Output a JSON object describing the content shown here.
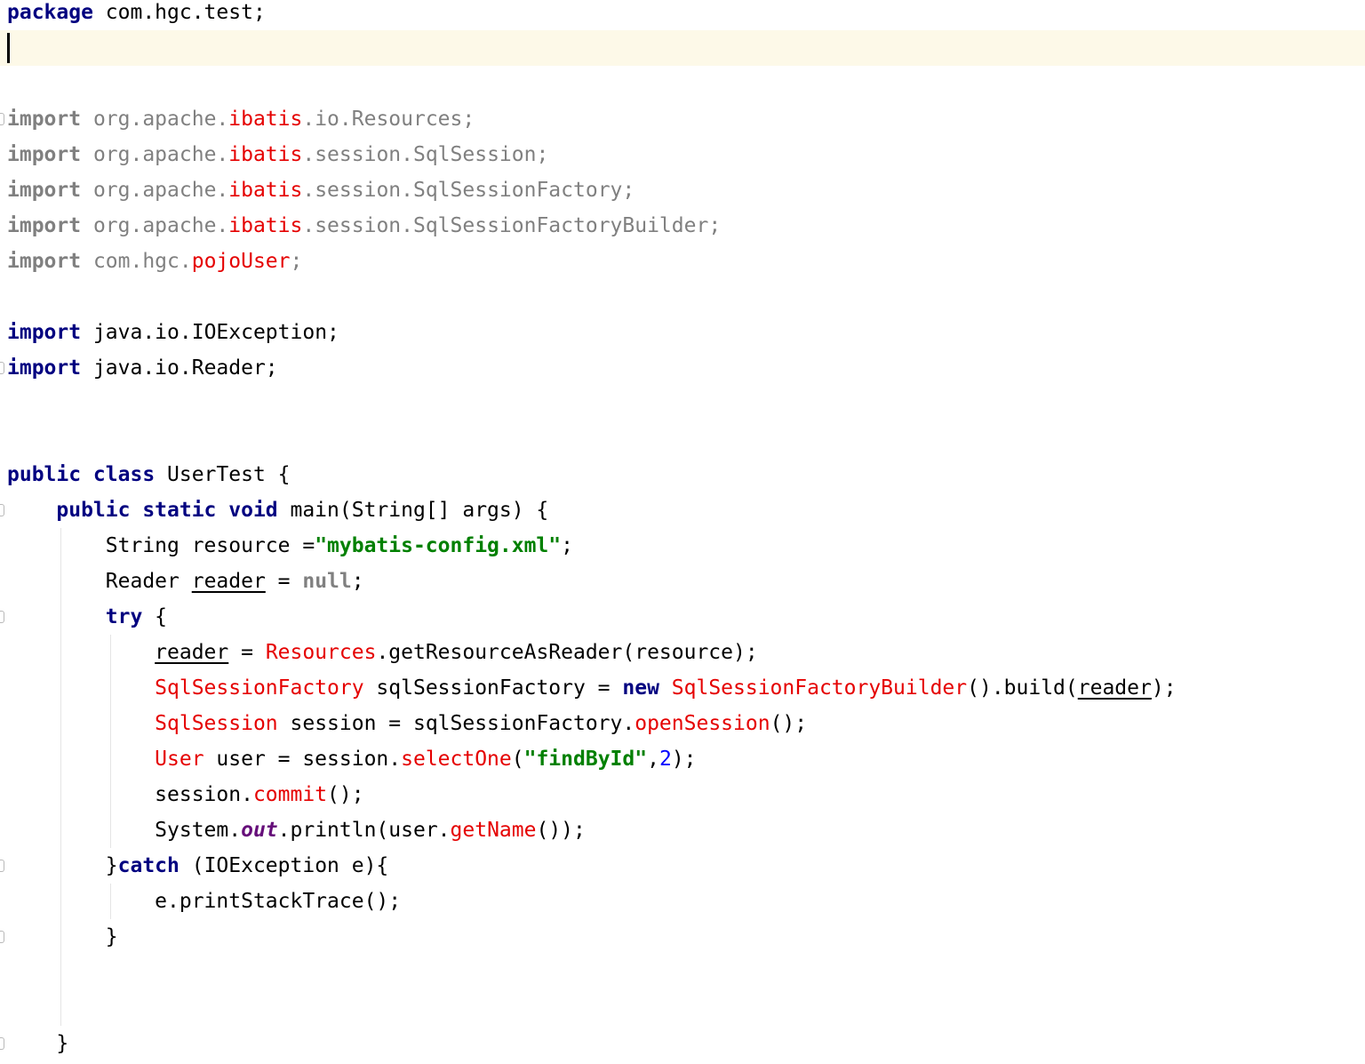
{
  "editor": {
    "lines": [
      {
        "tokens": [
          {
            "t": "package",
            "c": "kw"
          },
          {
            "t": " com.hgc.test;"
          }
        ]
      },
      {
        "tokens": []
      },
      {
        "tokens": []
      },
      {
        "tokens": [
          {
            "t": "import",
            "c": "kwg"
          },
          {
            "t": " org.apache.",
            "c": "gray"
          },
          {
            "t": "ibatis",
            "c": "err"
          },
          {
            "t": ".io.Resources;",
            "c": "gray"
          }
        ]
      },
      {
        "tokens": [
          {
            "t": "import",
            "c": "kwg"
          },
          {
            "t": " org.apache.",
            "c": "gray"
          },
          {
            "t": "ibatis",
            "c": "err"
          },
          {
            "t": ".session.SqlSession;",
            "c": "gray"
          }
        ]
      },
      {
        "tokens": [
          {
            "t": "import",
            "c": "kwg"
          },
          {
            "t": " org.apache.",
            "c": "gray"
          },
          {
            "t": "ibatis",
            "c": "err"
          },
          {
            "t": ".session.SqlSessionFactory;",
            "c": "gray"
          }
        ]
      },
      {
        "tokens": [
          {
            "t": "import",
            "c": "kwg"
          },
          {
            "t": " org.apache.",
            "c": "gray"
          },
          {
            "t": "ibatis",
            "c": "err"
          },
          {
            "t": ".session.SqlSessionFactoryBuilder;",
            "c": "gray"
          }
        ]
      },
      {
        "tokens": [
          {
            "t": "import",
            "c": "kwg"
          },
          {
            "t": " com.hgc.",
            "c": "gray"
          },
          {
            "t": "pojoUser",
            "c": "err"
          },
          {
            "t": ";",
            "c": "gray"
          }
        ]
      },
      {
        "tokens": []
      },
      {
        "tokens": [
          {
            "t": "import",
            "c": "kw"
          },
          {
            "t": " java.io.IOException;"
          }
        ]
      },
      {
        "tokens": [
          {
            "t": "import",
            "c": "kw"
          },
          {
            "t": " java.io.Reader;"
          }
        ]
      },
      {
        "tokens": []
      },
      {
        "tokens": []
      },
      {
        "tokens": [
          {
            "t": "public class",
            "c": "kw"
          },
          {
            "t": " UserTest {"
          }
        ]
      },
      {
        "tokens": [
          {
            "t": "    "
          },
          {
            "t": "public static void",
            "c": "kw"
          },
          {
            "t": " main(String[] args) {"
          }
        ]
      },
      {
        "tokens": [
          {
            "t": "        String resource ="
          },
          {
            "t": "\"mybatis-config.xml\"",
            "c": "str"
          },
          {
            "t": ";"
          }
        ]
      },
      {
        "tokens": [
          {
            "t": "        Reader "
          },
          {
            "t": "reader",
            "c": "ul"
          },
          {
            "t": " = "
          },
          {
            "t": "null",
            "c": "kwg"
          },
          {
            "t": ";"
          }
        ]
      },
      {
        "tokens": [
          {
            "t": "        "
          },
          {
            "t": "try",
            "c": "kw"
          },
          {
            "t": " {"
          }
        ]
      },
      {
        "tokens": [
          {
            "t": "            "
          },
          {
            "t": "reader",
            "c": "ul"
          },
          {
            "t": " = "
          },
          {
            "t": "Resources",
            "c": "err"
          },
          {
            "t": ".getResourceAsReader(resource);"
          }
        ]
      },
      {
        "tokens": [
          {
            "t": "            "
          },
          {
            "t": "SqlSessionFactory",
            "c": "err"
          },
          {
            "t": " sqlSessionFactory = "
          },
          {
            "t": "new",
            "c": "kw"
          },
          {
            "t": " "
          },
          {
            "t": "SqlSessionFactoryBuilder",
            "c": "err"
          },
          {
            "t": "().build("
          },
          {
            "t": "reader",
            "c": "ul"
          },
          {
            "t": ");"
          }
        ]
      },
      {
        "tokens": [
          {
            "t": "            "
          },
          {
            "t": "SqlSession",
            "c": "err"
          },
          {
            "t": " session = sqlSessionFactory."
          },
          {
            "t": "openSession",
            "c": "err"
          },
          {
            "t": "();"
          }
        ]
      },
      {
        "tokens": [
          {
            "t": "            "
          },
          {
            "t": "User",
            "c": "err"
          },
          {
            "t": " user = session."
          },
          {
            "t": "selectOne",
            "c": "err"
          },
          {
            "t": "("
          },
          {
            "t": "\"findById\"",
            "c": "str"
          },
          {
            "t": ","
          },
          {
            "t": "2",
            "c": "num"
          },
          {
            "t": ");"
          }
        ]
      },
      {
        "tokens": [
          {
            "t": "            session."
          },
          {
            "t": "commit",
            "c": "err"
          },
          {
            "t": "();"
          }
        ]
      },
      {
        "tokens": [
          {
            "t": "            System."
          },
          {
            "t": "out",
            "c": "field"
          },
          {
            "t": ".println(user."
          },
          {
            "t": "getName",
            "c": "err"
          },
          {
            "t": "());"
          }
        ]
      },
      {
        "tokens": [
          {
            "t": "        }"
          },
          {
            "t": "catch",
            "c": "kw"
          },
          {
            "t": " (IOException e){"
          }
        ]
      },
      {
        "tokens": [
          {
            "t": "            e.printStackTrace();"
          }
        ]
      },
      {
        "tokens": [
          {
            "t": "        }"
          }
        ]
      },
      {
        "tokens": []
      },
      {
        "tokens": []
      },
      {
        "tokens": [
          {
            "t": "    }"
          }
        ]
      }
    ]
  }
}
